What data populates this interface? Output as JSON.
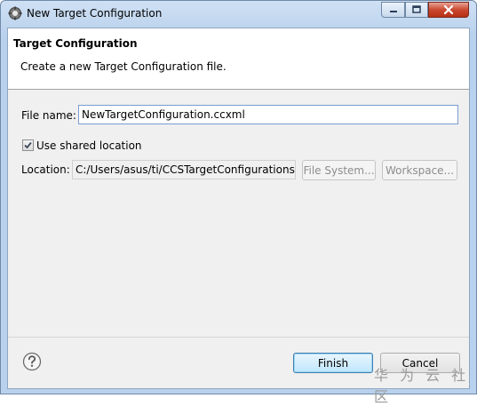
{
  "window": {
    "title": "New Target Configuration",
    "icon": "eclipse-gear-icon"
  },
  "header": {
    "title": "Target Configuration",
    "description": "Create a new Target Configuration file."
  },
  "form": {
    "file_name_label": "File name:",
    "file_name_value": "NewTargetConfiguration.ccxml",
    "shared_location_label": "Use shared location",
    "shared_location_checked": true,
    "location_label": "Location:",
    "location_value": "C:/Users/asus/ti/CCSTargetConfigurations",
    "file_system_label": "File System...",
    "workspace_label": "Workspace..."
  },
  "footer": {
    "help_icon": "question-circle-icon",
    "finish_label": "Finish",
    "cancel_label": "Cancel"
  },
  "watermark": "华 为 云 社 区"
}
